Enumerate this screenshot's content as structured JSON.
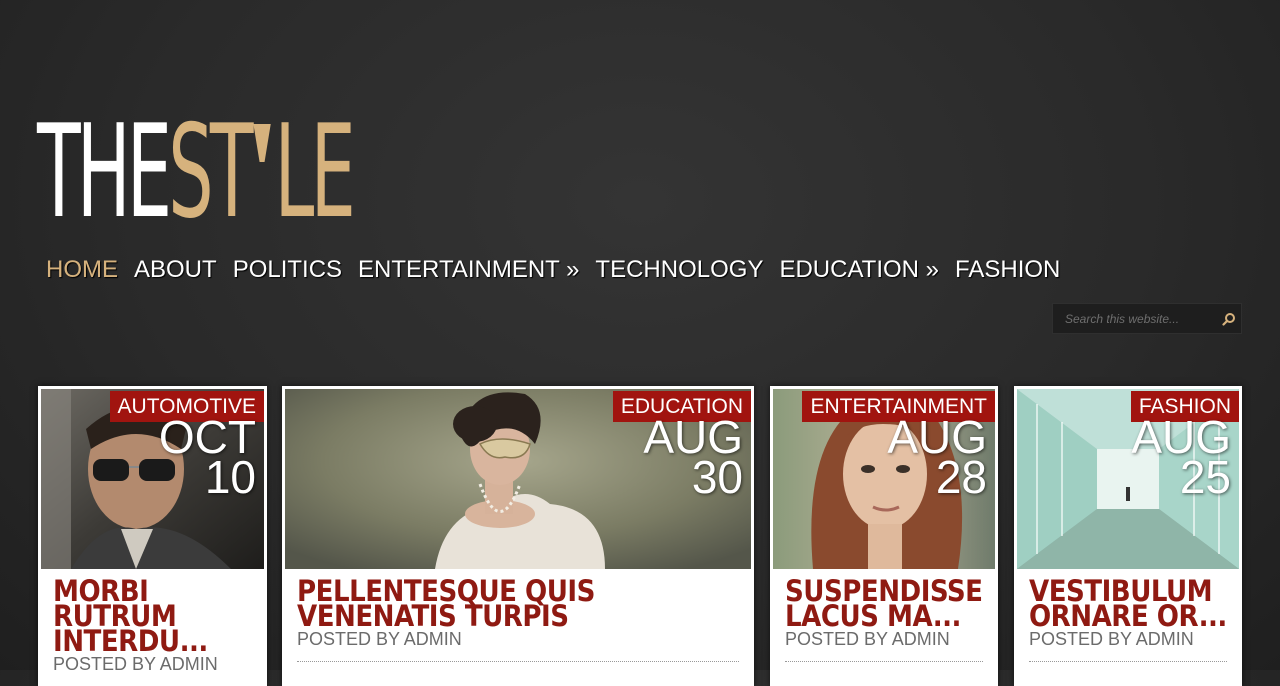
{
  "logo": {
    "part1": "THE",
    "part2": "ST",
    "part3": "LE"
  },
  "nav": {
    "home": "HOME",
    "about": "ABOUT",
    "politics": "POLITICS",
    "entertainment": "ENTERTAINMENT »",
    "technology": "TECHNOLOGY",
    "education": "EDUCATION »",
    "fashion": "FASHION"
  },
  "search": {
    "placeholder": "Search this website..."
  },
  "posts": [
    {
      "category": "AUTOMOTIVE",
      "month": "OCT",
      "day": "10",
      "title": "MORBI RUTRUM INTERDU...",
      "meta": "POSTED BY ADMIN"
    },
    {
      "category": "EDUCATION",
      "month": "AUG",
      "day": "30",
      "title": "PELLENTESQUE QUIS VENENATIS TURPIS",
      "meta": "POSTED BY ADMIN"
    },
    {
      "category": "ENTERTAINMENT",
      "month": "AUG",
      "day": "28",
      "title": "SUSPENDISSE LACUS MA...",
      "meta": "POSTED BY ADMIN"
    },
    {
      "category": "FASHION",
      "month": "AUG",
      "day": "25",
      "title": "VESTIBULUM ORNARE OR...",
      "meta": "POSTED BY ADMIN"
    }
  ],
  "colors": {
    "accent": "#d6b27d",
    "badge": "#a1140f",
    "title": "#8f1a12"
  }
}
